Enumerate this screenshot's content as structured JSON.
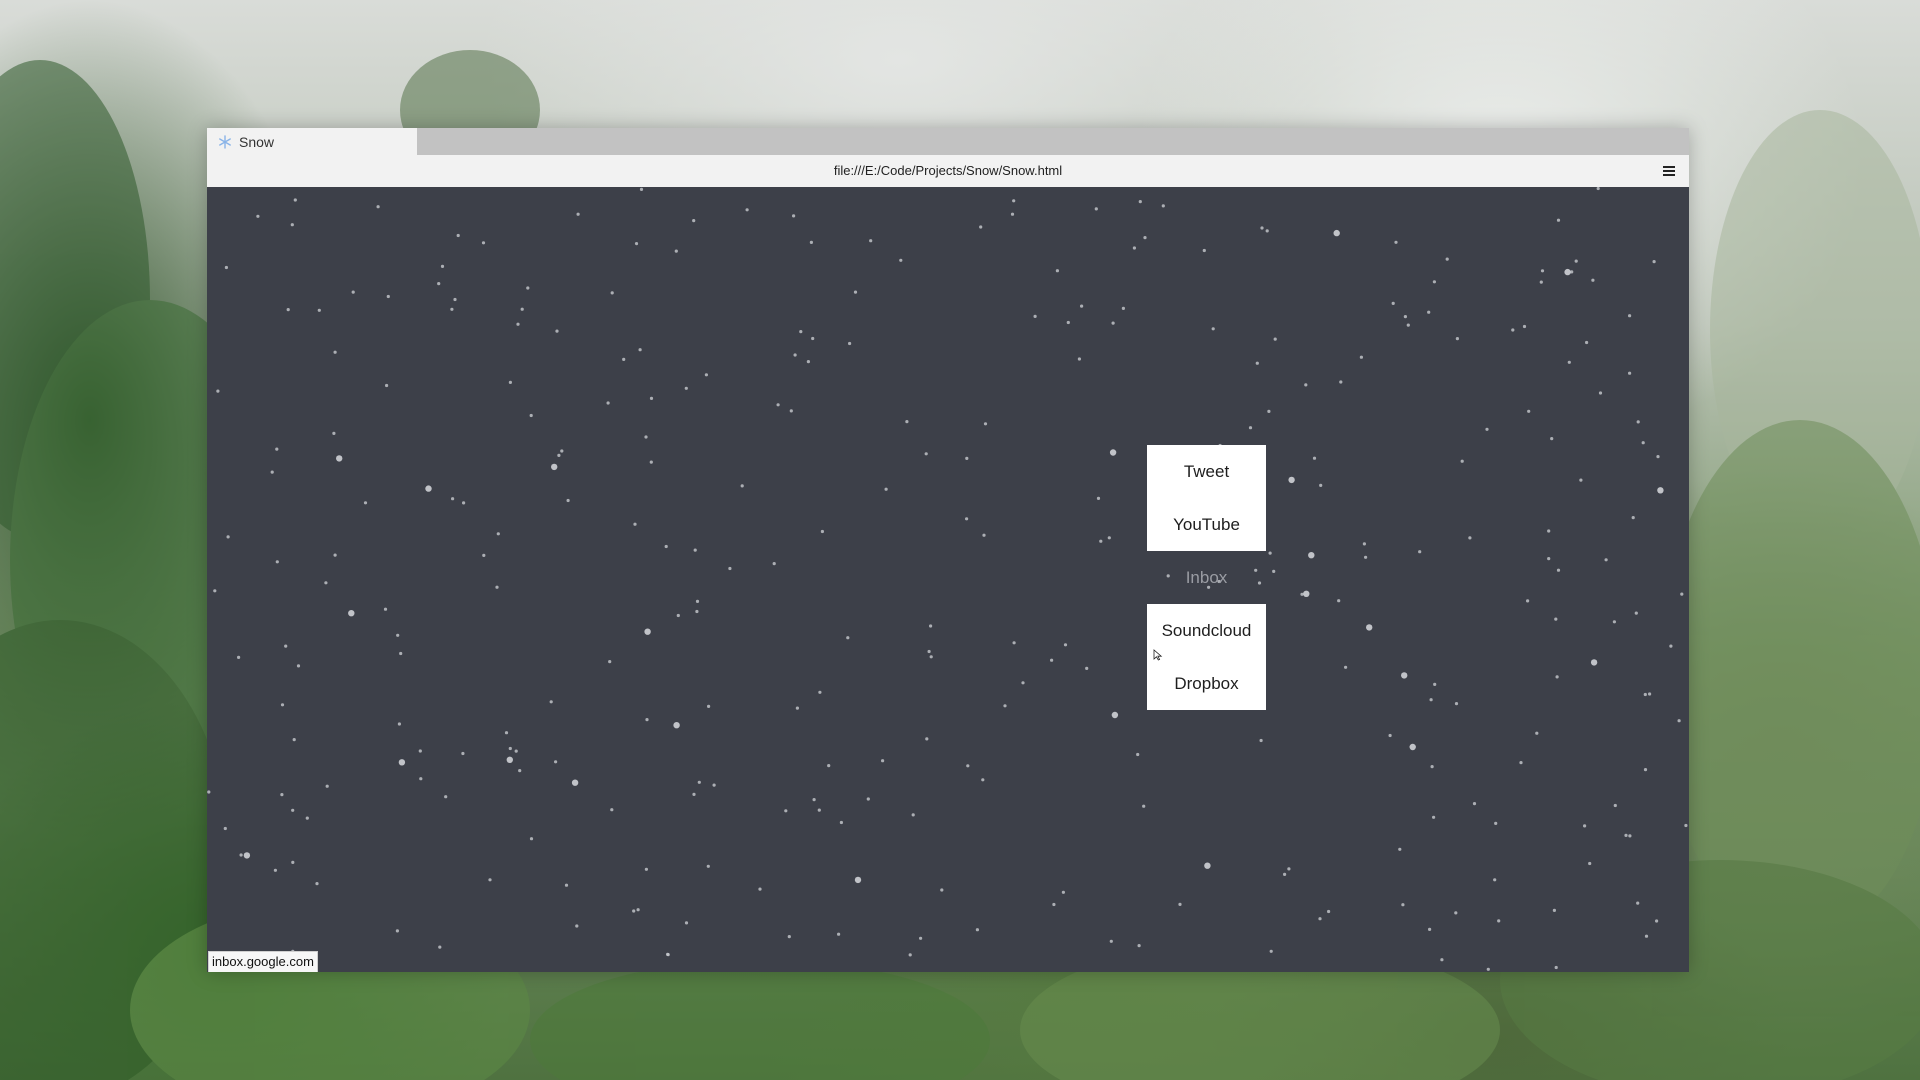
{
  "tab": {
    "title": "Snow",
    "icon": "snowflake-icon"
  },
  "address_bar": {
    "url": "file:///E:/Code/Projects/Snow/Snow.html",
    "menu_icon": "hamburger-menu-icon"
  },
  "links": [
    {
      "label": "Tweet"
    },
    {
      "label": "YouTube"
    },
    {
      "label": "Inbox",
      "state": "hovered"
    },
    {
      "label": "Soundcloud"
    },
    {
      "label": "Dropbox"
    }
  ],
  "status_bar": {
    "text": "inbox.google.com"
  },
  "colors": {
    "page_background": "#3d4049",
    "snow": "#c8cad0",
    "tab_active": "#f2f2f2",
    "tab_strip": "#c2c2c2"
  }
}
